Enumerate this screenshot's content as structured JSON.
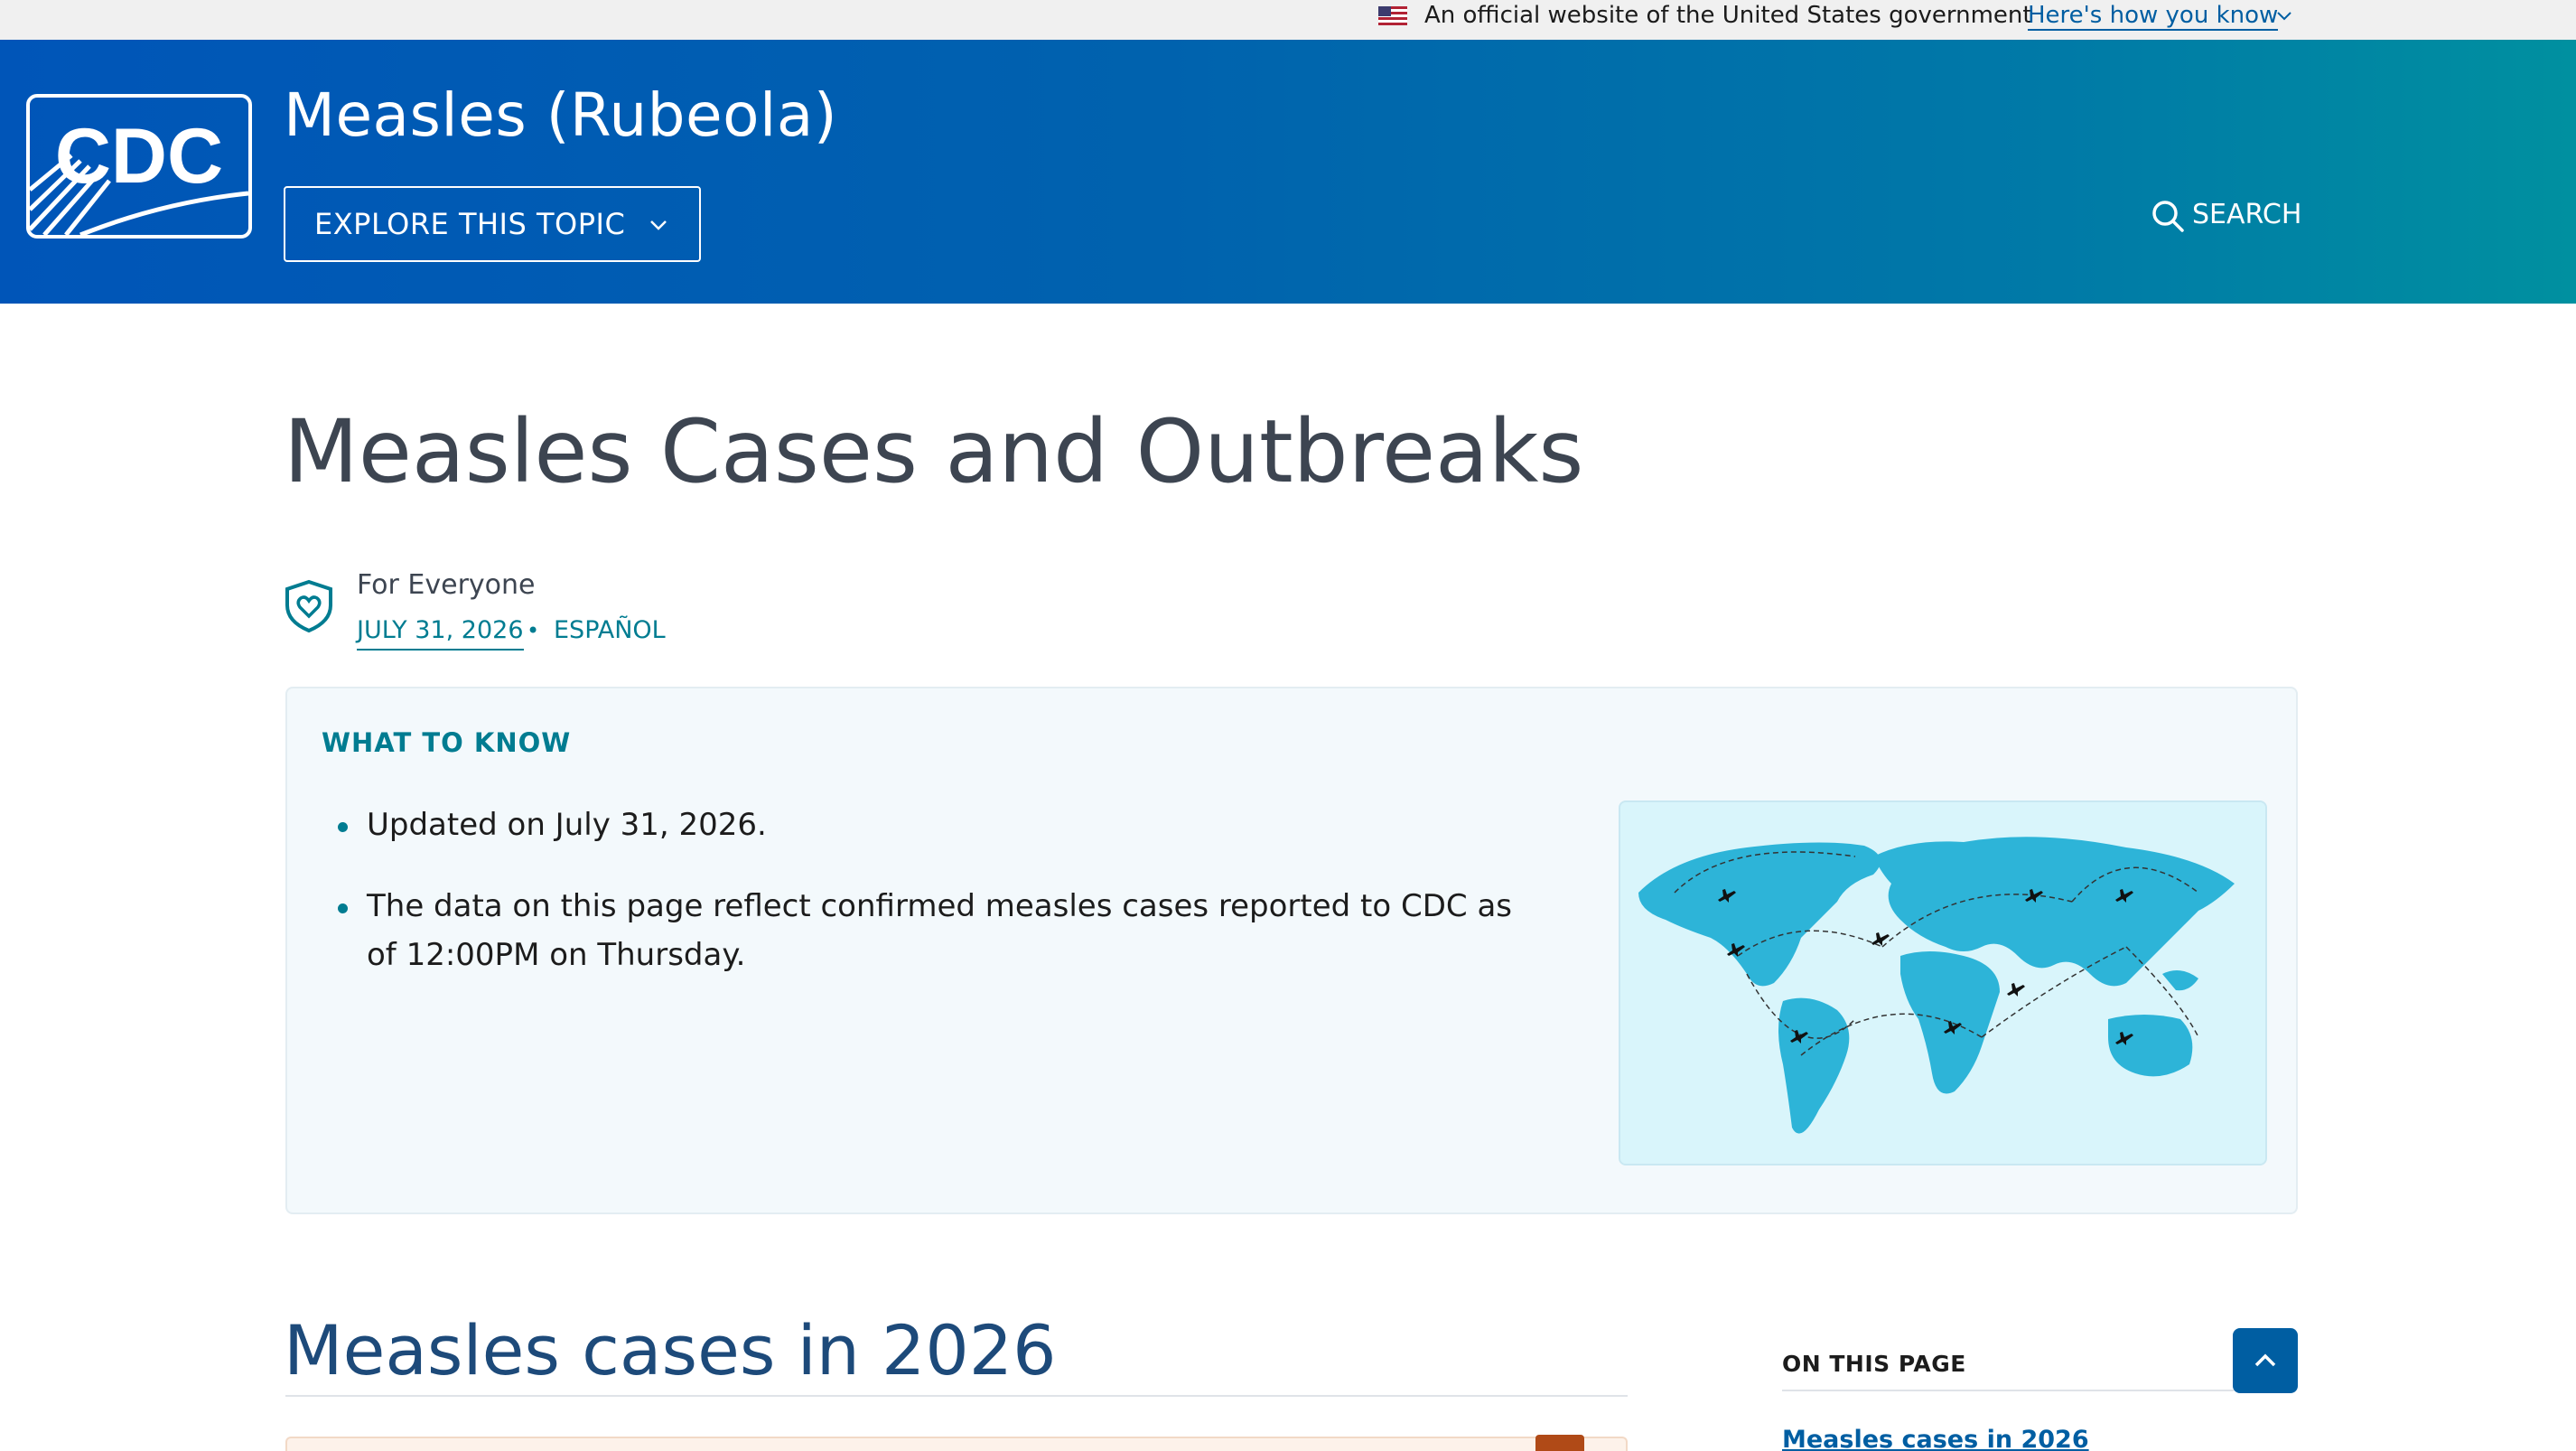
{
  "gov_banner": {
    "official_text": "An official website of the United States government",
    "how_link": "Here's how you know"
  },
  "header": {
    "logo_text": "CDC",
    "site_title": "Measles (Rubeola)",
    "explore_button": "EXPLORE THIS TOPIC",
    "search_label": "SEARCH"
  },
  "page": {
    "title": "Measles Cases and Outbreaks",
    "audience": "For Everyone",
    "date": "JULY 31, 2026",
    "separator": "•",
    "language_link": "ESPAÑOL"
  },
  "what_to_know": {
    "title": "WHAT TO KNOW",
    "bullets": [
      "Updated on July 31, 2026.",
      "The data on this page reflect confirmed measles cases reported to CDC as of 12:00PM on Thursday."
    ]
  },
  "section": {
    "heading": "Measles cases in 2026"
  },
  "on_this_page": {
    "title": "ON THIS PAGE",
    "links": [
      "Measles cases in 2026"
    ]
  },
  "colors": {
    "header_start": "#0055b8",
    "header_end": "#0090a0",
    "accent_teal": "#007c91",
    "link_blue": "#005ea2",
    "heading_blue": "#1d4a7a"
  },
  "icons": [
    "us-flag-icon",
    "chevron-down-icon",
    "search-icon",
    "audience-shield-icon",
    "chevron-up-icon"
  ]
}
